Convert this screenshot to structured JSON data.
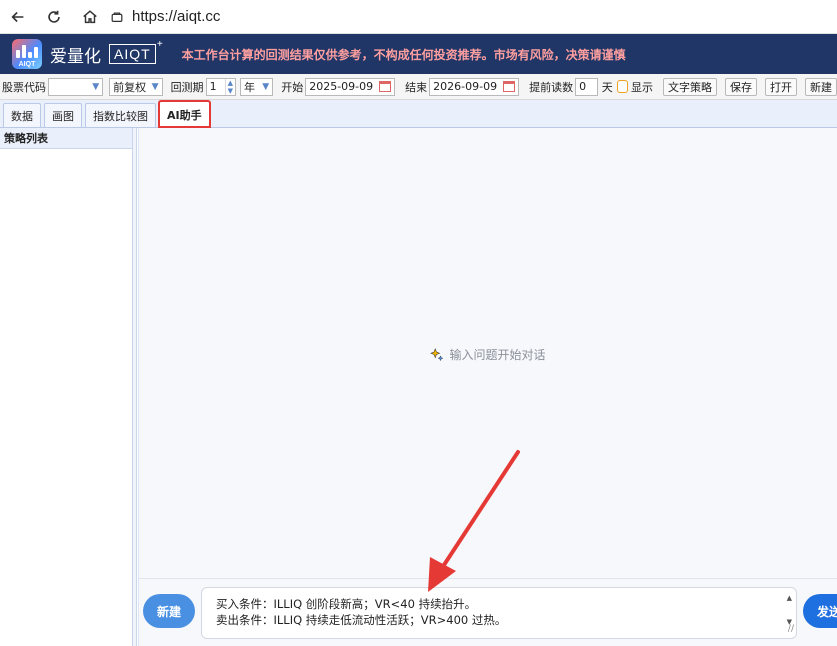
{
  "browser": {
    "url": "https://aiqt.cc",
    "icons": [
      "back-arrow-icon",
      "reload-icon",
      "home-icon",
      "site-info-icon"
    ]
  },
  "header": {
    "brand_name": "爱量化",
    "brand_badge": "AIQT",
    "logo_text": "AIQT",
    "disclaimer": "本工作台计算的回测结果仅供参考，不构成任何投资推荐。市场有风险，决策请谨慎",
    "colors": {
      "background": "#1f3667",
      "disclaimer": "#ff9f9f"
    }
  },
  "toolbar": {
    "stock_code_label": "股票代码",
    "stock_code_value": "",
    "adjust_value": "前复权",
    "backtest_label": "回测期",
    "backtest_value": "1",
    "period_unit": "年",
    "start_label": "开始",
    "start_date": "2025-09-09",
    "end_label": "结束",
    "end_date": "2026-09-09",
    "lookahead_label": "提前读数",
    "lookahead_value": "0",
    "lookahead_unit": "天",
    "show_label": "显示",
    "text_strategy_button": "文字策略",
    "save_button": "保存",
    "open_button": "打开",
    "new_button": "新建"
  },
  "tabs": [
    {
      "label": "数据",
      "active": false
    },
    {
      "label": "画图",
      "active": false
    },
    {
      "label": "指数比较图",
      "active": false
    },
    {
      "label": "AI助手",
      "active": true
    }
  ],
  "sidebar": {
    "title": "策略列表"
  },
  "chat": {
    "empty_hint": "输入问题开始对话",
    "new_button": "新建",
    "send_button": "发送",
    "input_lines": [
      "买入条件：ILLIQ 创阶段新高；VR<40 持续抬升。",
      "卖出条件：ILLIQ 持续走低流动性活跃；VR>400 过热。"
    ],
    "colors": {
      "new_button": "#4a90e2",
      "send_button": "#1e6fe0",
      "active_tab_outline": "#e53935",
      "arrow": "#e53935"
    }
  }
}
